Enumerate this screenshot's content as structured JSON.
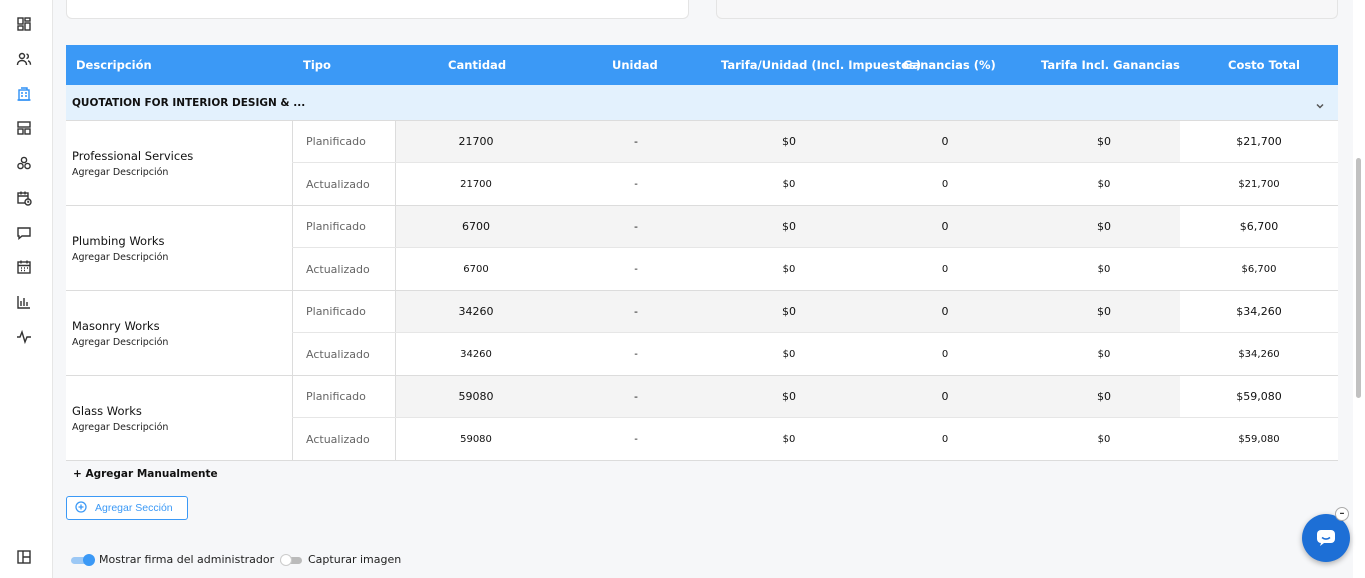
{
  "sidebar": {
    "icons": [
      "dashboard-icon",
      "users-icon",
      "building-icon",
      "layout-icon",
      "modules-icon",
      "calendar-clock-icon",
      "chat-icon",
      "calendar-icon",
      "bar-chart-icon",
      "activity-icon",
      "panel-toggle-icon"
    ],
    "active": "building-icon"
  },
  "table": {
    "headers": {
      "descripcion": "Descripción",
      "tipo": "Tipo",
      "cantidad": "Cantidad",
      "unidad": "Unidad",
      "tarifa": "Tarifa/Unidad (Incl. Impuestos)",
      "ganancias": "Ganancias (%)",
      "tarifa_ganancias": "Tarifa Incl. Ganancias",
      "costo_total": "Costo Total"
    },
    "section_title": "QUOTATION FOR INTERIOR DESIGN & ...",
    "items": [
      {
        "name": "Professional Services",
        "desc": "Agregar Descripción",
        "planned": {
          "tipo": "Planificado",
          "cantidad": "21700",
          "unidad": "-",
          "tarifa": "$0",
          "ganancias": "0",
          "tarifa_ganancias": "$0",
          "costo": "$21,700"
        },
        "updated": {
          "tipo": "Actualizado",
          "cantidad": "21700",
          "unidad": "-",
          "tarifa": "$0",
          "ganancias": "0",
          "tarifa_ganancias": "$0",
          "costo": "$21,700"
        }
      },
      {
        "name": "Plumbing Works",
        "desc": "Agregar Descripción",
        "planned": {
          "tipo": "Planificado",
          "cantidad": "6700",
          "unidad": "-",
          "tarifa": "$0",
          "ganancias": "0",
          "tarifa_ganancias": "$0",
          "costo": "$6,700"
        },
        "updated": {
          "tipo": "Actualizado",
          "cantidad": "6700",
          "unidad": "-",
          "tarifa": "$0",
          "ganancias": "0",
          "tarifa_ganancias": "$0",
          "costo": "$6,700"
        }
      },
      {
        "name": "Masonry Works",
        "desc": "Agregar Descripción",
        "planned": {
          "tipo": "Planificado",
          "cantidad": "34260",
          "unidad": "-",
          "tarifa": "$0",
          "ganancias": "0",
          "tarifa_ganancias": "$0",
          "costo": "$34,260"
        },
        "updated": {
          "tipo": "Actualizado",
          "cantidad": "34260",
          "unidad": "-",
          "tarifa": "$0",
          "ganancias": "0",
          "tarifa_ganancias": "$0",
          "costo": "$34,260"
        }
      },
      {
        "name": "Glass Works",
        "desc": "Agregar Descripción",
        "planned": {
          "tipo": "Planificado",
          "cantidad": "59080",
          "unidad": "-",
          "tarifa": "$0",
          "ganancias": "0",
          "tarifa_ganancias": "$0",
          "costo": "$59,080"
        },
        "updated": {
          "tipo": "Actualizado",
          "cantidad": "59080",
          "unidad": "-",
          "tarifa": "$0",
          "ganancias": "0",
          "tarifa_ganancias": "$0",
          "costo": "$59,080"
        }
      }
    ]
  },
  "actions": {
    "add_manual": "+ Agregar Manualmente",
    "add_section": "Agregar Sección"
  },
  "toggles": {
    "admin_signature": {
      "label": "Mostrar firma del administrador",
      "on": true
    },
    "capture_image": {
      "label": "Capturar imagen",
      "on": false
    }
  },
  "colors": {
    "accent": "#3b99f6",
    "section_bg": "#e3f1fd",
    "chat": "#1d6fd6"
  }
}
